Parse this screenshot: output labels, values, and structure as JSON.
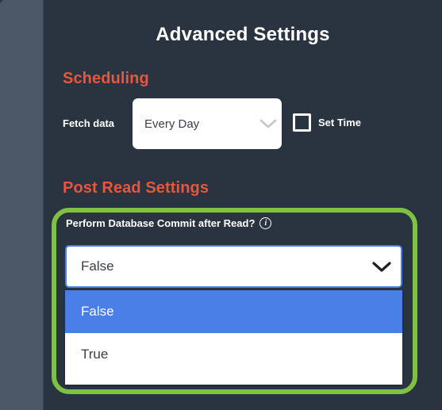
{
  "page": {
    "title": "Advanced Settings",
    "background_color": "#2a3441",
    "rail_color": "#4c5768",
    "heading_color": "#e8563c",
    "highlight_color": "#7fc241",
    "accent_blue": "#4a7fe8"
  },
  "sections": {
    "scheduling": {
      "heading": "Scheduling",
      "fetch_label": "Fetch data",
      "fetch_select": {
        "value": "Every Day",
        "icon": "chevron-down-icon"
      },
      "set_time": {
        "label": "Set Time",
        "checked": false
      }
    },
    "post_read": {
      "heading": "Post Read Settings",
      "commit_label": "Perform Database Commit after Read?",
      "info_icon": "info-icon",
      "info_glyph": "i",
      "commit_select": {
        "value": "False",
        "icon": "chevron-down-icon",
        "expanded": true,
        "options": [
          {
            "label": "False",
            "selected": true
          },
          {
            "label": "True",
            "selected": false
          }
        ]
      }
    }
  }
}
